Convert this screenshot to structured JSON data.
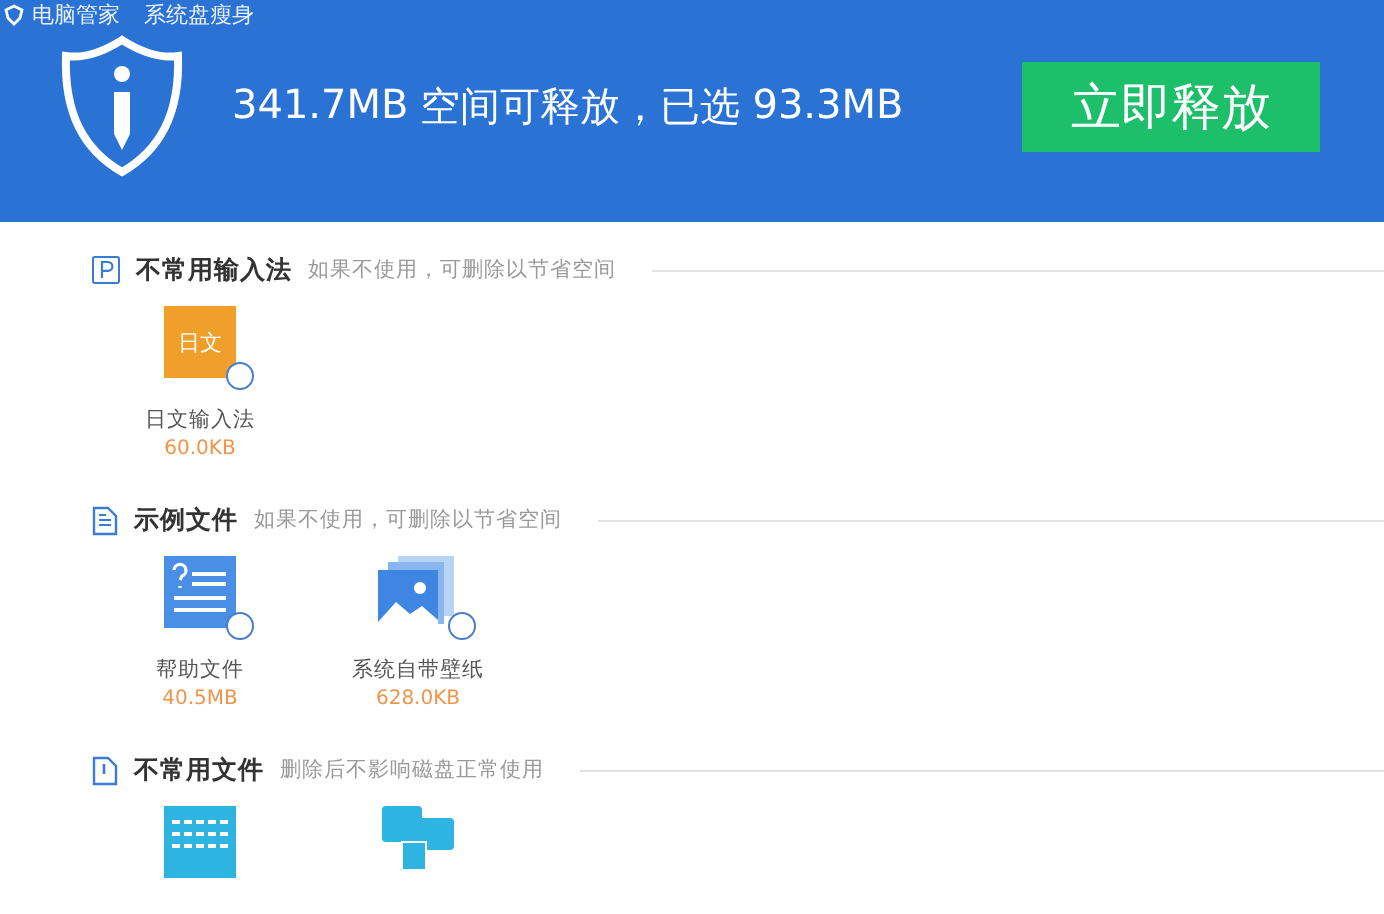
{
  "window": {
    "app": "电脑管家",
    "title": "系统盘瘦身"
  },
  "header": {
    "size": "341.7MB",
    "text": "空间可释放，已选",
    "selected_size": "93.3MB",
    "button": "立即释放"
  },
  "sections": [
    {
      "kind": "p",
      "title": "不常用输入法",
      "hint": "如果不使用，可删除以节省空间",
      "items": [
        {
          "kind": "ime",
          "icon_text": "日文",
          "name": "日文输入法",
          "size": "60.0KB",
          "checked": false
        }
      ]
    },
    {
      "kind": "doc",
      "title": "示例文件",
      "hint": "如果不使用，可删除以节省空间",
      "items": [
        {
          "kind": "help",
          "name": "帮助文件",
          "size": "40.5MB",
          "checked": false
        },
        {
          "kind": "wallpaper",
          "name": "系统自带壁纸",
          "size": "628.0KB",
          "checked": false
        }
      ]
    },
    {
      "kind": "file",
      "title": "不常用文件",
      "hint": "删除后不影响磁盘正常使用",
      "items": [
        {
          "kind": "keyboard"
        },
        {
          "kind": "window"
        }
      ]
    }
  ]
}
